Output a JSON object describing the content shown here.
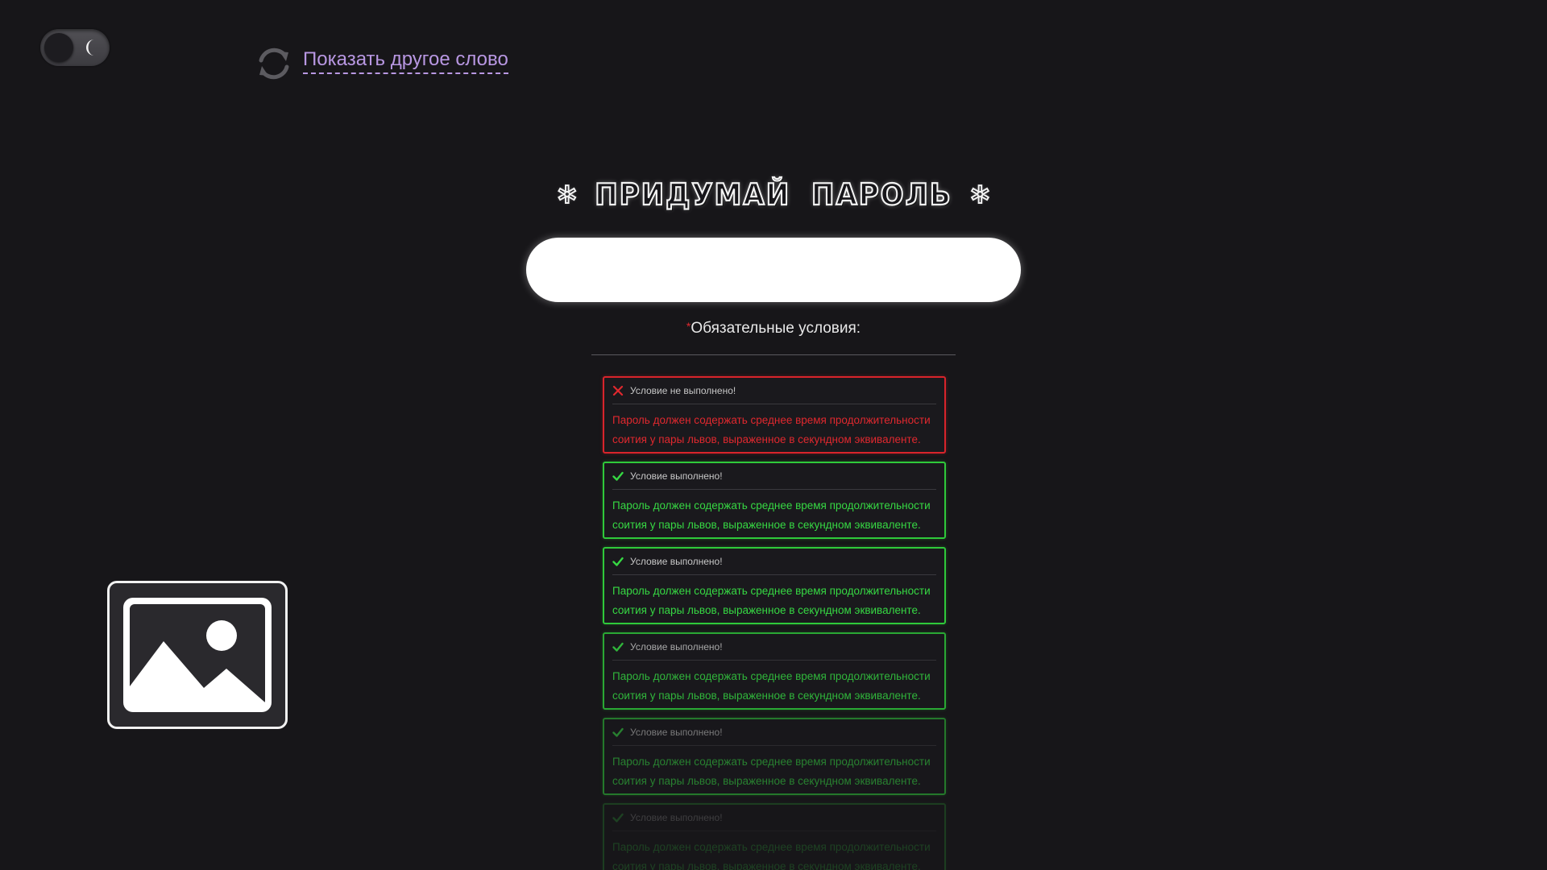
{
  "header": {
    "refresh_label": "Показать другое слово"
  },
  "theme_toggle": {
    "mode": "dark"
  },
  "main": {
    "title": "ПРИДУМАЙ ПАРОЛЬ",
    "title_star_left": "✲",
    "title_star_right": "✲",
    "password_value": "",
    "required_mark": "*",
    "conditions_title": "Обязательные условия:"
  },
  "conditions": [
    {
      "status": "fail",
      "header": "Условие не выполнено!",
      "text": "Пароль должен содержать среднее время продолжительности соития у пары львов, выраженное в секундном эквиваленте."
    },
    {
      "status": "ok",
      "header": "Условие выполнено!",
      "text": "Пароль должен содержать среднее время продолжительности соития у пары львов, выраженное в секундном эквиваленте."
    },
    {
      "status": "ok",
      "header": "Условие выполнено!",
      "text": "Пароль должен содержать среднее время продолжительности соития у пары львов, выраженное в секундном эквиваленте."
    },
    {
      "status": "ok",
      "header": "Условие выполнено!",
      "text": "Пароль должен содержать среднее время продолжительности соития у пары львов, выраженное в секундном эквиваленте."
    },
    {
      "status": "ok",
      "header": "Условие выполнено!",
      "text": "Пароль должен содержать среднее время продолжительности соития у пары львов, выраженное в секундном эквиваленте."
    },
    {
      "status": "ok",
      "header": "Условие выполнено!",
      "text": "Пароль должен содержать среднее время продолжительности соития у пары львов, выраженное в секундном эквиваленте."
    }
  ],
  "colors": {
    "background": "#171619",
    "accent_link": "#b897e2",
    "fail": "#e0282e",
    "ok": "#36d843"
  },
  "icons": {
    "theme": "moon-icon",
    "refresh": "refresh-icon",
    "fail": "cross-icon",
    "ok": "check-icon",
    "placeholder": "image-icon"
  }
}
